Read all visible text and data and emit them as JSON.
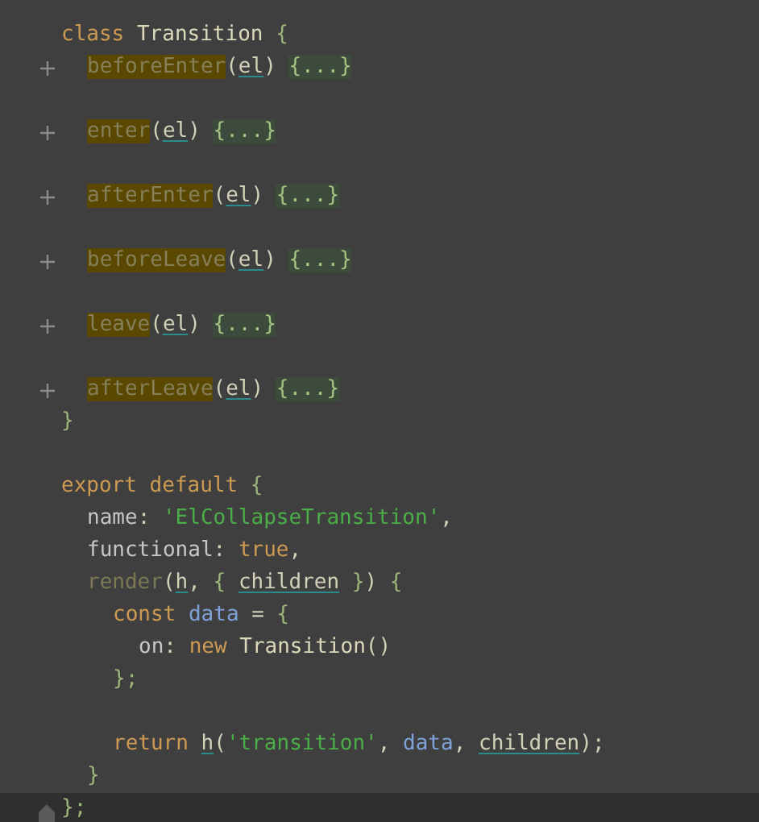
{
  "editor": {
    "lines": [
      {
        "tokens": [
          {
            "text": "class ",
            "kind": "keyword"
          },
          {
            "text": "Transition",
            "kind": "class"
          },
          {
            "text": " {",
            "kind": "brace"
          }
        ],
        "children": [
          {
            "folded": true,
            "tokens": [
              {
                "text": "beforeEnter",
                "kind": "match"
              },
              {
                "text": "(",
                "kind": "punct"
              },
              {
                "text": "el",
                "kind": "param"
              },
              {
                "text": ") ",
                "kind": "punct"
              },
              {
                "text": "{...}",
                "kind": "fold"
              }
            ]
          },
          {
            "space_before": true,
            "folded": true,
            "tokens": [
              {
                "text": "enter",
                "kind": "match"
              },
              {
                "text": "(",
                "kind": "punct"
              },
              {
                "text": "el",
                "kind": "param"
              },
              {
                "text": ") ",
                "kind": "punct"
              },
              {
                "text": "{...}",
                "kind": "fold"
              }
            ]
          },
          {
            "space_before": true,
            "folded": true,
            "tokens": [
              {
                "text": "afterEnter",
                "kind": "match"
              },
              {
                "text": "(",
                "kind": "punct"
              },
              {
                "text": "el",
                "kind": "param"
              },
              {
                "text": ") ",
                "kind": "punct"
              },
              {
                "text": "{...}",
                "kind": "fold"
              }
            ]
          },
          {
            "space_before": true,
            "folded": true,
            "tokens": [
              {
                "text": "beforeLeave",
                "kind": "match"
              },
              {
                "text": "(",
                "kind": "punct"
              },
              {
                "text": "el",
                "kind": "param"
              },
              {
                "text": ") ",
                "kind": "punct"
              },
              {
                "text": "{...}",
                "kind": "fold"
              }
            ]
          },
          {
            "space_before": true,
            "folded": true,
            "tokens": [
              {
                "text": "leave",
                "kind": "match"
              },
              {
                "text": "(",
                "kind": "punct"
              },
              {
                "text": "el",
                "kind": "param"
              },
              {
                "text": ") ",
                "kind": "punct"
              },
              {
                "text": "{...}",
                "kind": "fold"
              }
            ]
          },
          {
            "space_before": true,
            "folded": true,
            "tokens": [
              {
                "text": "afterLeave",
                "kind": "match"
              },
              {
                "text": "(",
                "kind": "punct"
              },
              {
                "text": "el",
                "kind": "param"
              },
              {
                "text": ") ",
                "kind": "punct"
              },
              {
                "text": "{...}",
                "kind": "fold"
              }
            ]
          }
        ]
      },
      {
        "tokens": [
          {
            "text": "}",
            "kind": "brace"
          }
        ]
      },
      {
        "space_before": true,
        "tokens": [
          {
            "text": "export default",
            "kind": "keyword"
          },
          {
            "text": " {",
            "kind": "brace"
          }
        ],
        "children": [
          {
            "tokens": [
              {
                "text": "name",
                "kind": "property"
              },
              {
                "text": ": ",
                "kind": "punct"
              },
              {
                "text": "'ElCollapseTransition'",
                "kind": "string"
              },
              {
                "text": ",",
                "kind": "punct"
              }
            ]
          },
          {
            "tokens": [
              {
                "text": "functional",
                "kind": "property"
              },
              {
                "text": ": ",
                "kind": "punct"
              },
              {
                "text": "true",
                "kind": "keyword"
              },
              {
                "text": ",",
                "kind": "punct"
              }
            ]
          },
          {
            "tokens": [
              {
                "text": "render",
                "kind": "unused"
              },
              {
                "text": "(",
                "kind": "punct"
              },
              {
                "text": "h",
                "kind": "param"
              },
              {
                "text": ", ",
                "kind": "punct"
              },
              {
                "text": "{ ",
                "kind": "brace"
              },
              {
                "text": "children",
                "kind": "param"
              },
              {
                "text": " }",
                "kind": "brace"
              },
              {
                "text": ") ",
                "kind": "punct"
              },
              {
                "text": "{",
                "kind": "brace"
              }
            ],
            "children": [
              {
                "tokens": [
                  {
                    "text": "const ",
                    "kind": "keyword"
                  },
                  {
                    "text": "data",
                    "kind": "variable"
                  },
                  {
                    "text": " = ",
                    "kind": "punct"
                  },
                  {
                    "text": "{",
                    "kind": "brace"
                  }
                ],
                "children": [
                  {
                    "tokens": [
                      {
                        "text": "on",
                        "kind": "property"
                      },
                      {
                        "text": ": ",
                        "kind": "punct"
                      },
                      {
                        "text": "new ",
                        "kind": "keyword"
                      },
                      {
                        "text": "Transition",
                        "kind": "class"
                      },
                      {
                        "text": "()",
                        "kind": "punct"
                      }
                    ]
                  }
                ]
              },
              {
                "tokens": [
                  {
                    "text": "};",
                    "kind": "brace"
                  }
                ]
              },
              {
                "space_before": true,
                "tokens": [
                  {
                    "text": "return ",
                    "kind": "keyword"
                  },
                  {
                    "text": "h",
                    "kind": "param"
                  },
                  {
                    "text": "(",
                    "kind": "punct"
                  },
                  {
                    "text": "'transition'",
                    "kind": "string"
                  },
                  {
                    "text": ", ",
                    "kind": "punct"
                  },
                  {
                    "text": "data",
                    "kind": "variable"
                  },
                  {
                    "text": ", ",
                    "kind": "punct"
                  },
                  {
                    "text": "children",
                    "kind": "param"
                  },
                  {
                    "text": ");",
                    "kind": "punct"
                  }
                ]
              }
            ]
          },
          {
            "tokens": [
              {
                "text": "}",
                "kind": "brace"
              }
            ]
          }
        ]
      },
      {
        "current": true,
        "fold_end": true,
        "tokens": [
          {
            "text": "};",
            "kind": "brace"
          }
        ]
      }
    ]
  }
}
